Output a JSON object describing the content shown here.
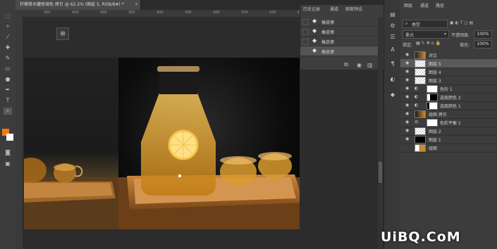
{
  "document": {
    "tab_title": "柠檬茶水罐修调色 拷贝 @ 62.2% (图层 5, RGB/8#) *",
    "close": "×"
  },
  "ruler_marks": [
    "500",
    "450",
    "400",
    "350",
    "300",
    "250",
    "200",
    "150",
    "100",
    "50"
  ],
  "history": {
    "tabs": [
      "历史记录",
      "通道",
      "图案预设"
    ],
    "items": [
      "橡皮擦",
      "橡皮擦",
      "橡皮擦",
      "橡皮擦"
    ]
  },
  "panel_tabs": [
    "图层",
    "通道",
    "路径"
  ],
  "layer_controls": {
    "filter_kind": "类型",
    "blend_mode": "柔光",
    "opacity_label": "不透明度:",
    "opacity_value": "100%",
    "lock_label": "锁定:",
    "fill_label": "填充:",
    "fill_value": "100%"
  },
  "layers": [
    {
      "name": "对比",
      "kind": "smart",
      "visible": true,
      "selected": false
    },
    {
      "name": "图层 5",
      "kind": "pixel",
      "visible": true,
      "selected": true
    },
    {
      "name": "图层 4",
      "kind": "pixel",
      "visible": true,
      "selected": false
    },
    {
      "name": "图层 3",
      "kind": "pixel",
      "visible": true,
      "selected": false
    },
    {
      "name": "色阶 1",
      "kind": "adjustment",
      "visible": true,
      "selected": false
    },
    {
      "name": "选取颜色 2",
      "kind": "adjustment",
      "visible": true,
      "selected": false
    },
    {
      "name": "选取颜色 1",
      "kind": "adjustment",
      "visible": true,
      "selected": false
    },
    {
      "name": "组图 拷贝",
      "kind": "photo",
      "visible": true,
      "selected": false
    },
    {
      "name": "色彩平衡 1",
      "kind": "adjustment",
      "visible": true,
      "selected": false
    },
    {
      "name": "图层 2",
      "kind": "pixel",
      "visible": true,
      "selected": false
    },
    {
      "name": "图层 1",
      "kind": "black",
      "visible": true,
      "selected": false
    },
    {
      "name": "组图",
      "kind": "photo",
      "visible": false,
      "selected": false
    }
  ],
  "watermark": "UiBQ.CoM",
  "colors": {
    "foreground": "#f07a10",
    "background": "#ffffff",
    "selection": "#5a5a5a"
  }
}
